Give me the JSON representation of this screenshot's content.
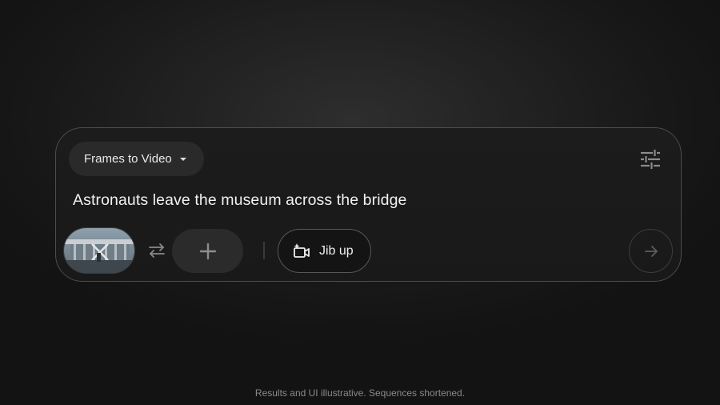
{
  "composer": {
    "mode_label": "Frames to Video",
    "prompt_text": "Astronauts leave the museum across the bridge",
    "jib_label": "Jib up"
  },
  "icons": {
    "mode_caret": "caret-down-icon",
    "settings": "sliders-icon",
    "swap": "swap-arrows-icon",
    "add": "plus-icon",
    "camera_motion": "camera-motion-icon",
    "send": "arrow-right-icon"
  },
  "footer": {
    "disclaimer": "Results and UI illustrative. Sequences shortened."
  }
}
